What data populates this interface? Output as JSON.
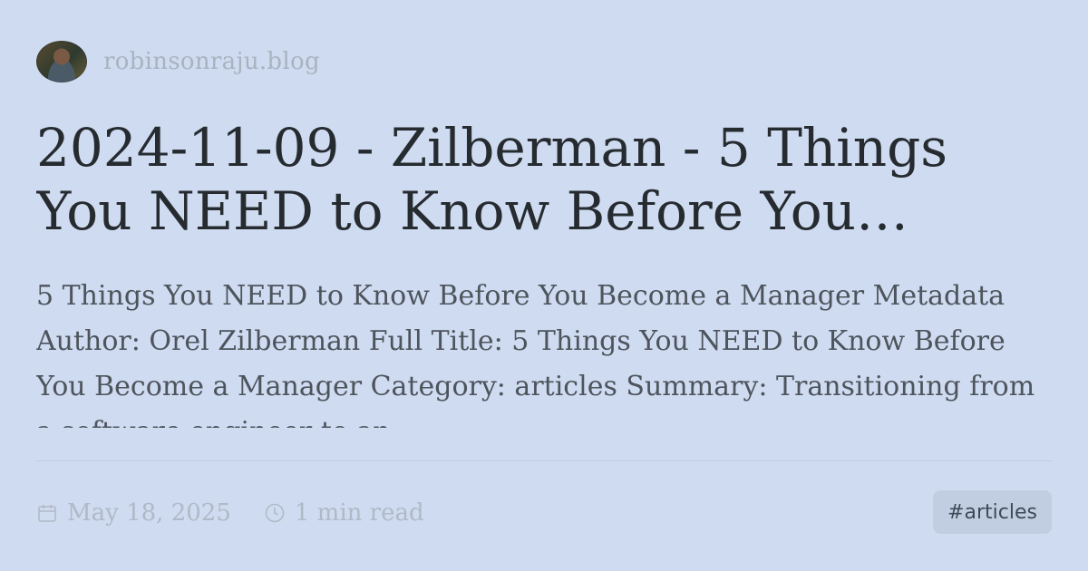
{
  "site": {
    "name": "robinsonraju.blog"
  },
  "post": {
    "title": "2024-11-09 - Zilberman - 5 Things You NEED to Know Before You Become a Manager",
    "excerpt": "5 Things You NEED to Know Before You Become a Manager Metadata Author: Orel Zilberman Full Title: 5 Things You NEED to Know Before You Become a Manager Category: articles Summary: Transitioning from a software engineer to an"
  },
  "meta": {
    "date": "May 18, 2025",
    "read_time": "1 min read",
    "date_icon": "calendar-icon",
    "time_icon": "clock-icon"
  },
  "tags": [
    "#articles"
  ],
  "colors": {
    "background": "#cfdbf1",
    "title": "#262b30",
    "muted": "#b0b9c6",
    "tag_bg": "#c1cee2"
  }
}
